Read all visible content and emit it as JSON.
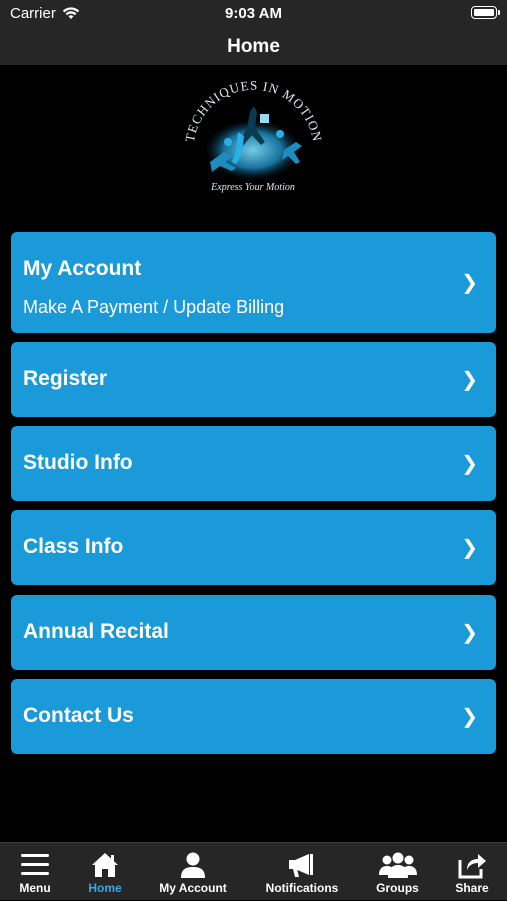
{
  "status_bar": {
    "carrier": "Carrier",
    "time": "9:03 AM"
  },
  "nav": {
    "title": "Home"
  },
  "logo": {
    "text_top": "TECHNIQUES IN MOTION",
    "tagline": "Express Your Motion"
  },
  "menu": [
    {
      "title": "My Account",
      "subtitle": "Make A Payment / Update Billing"
    },
    {
      "title": "Register"
    },
    {
      "title": "Studio Info"
    },
    {
      "title": "Class Info"
    },
    {
      "title": "Annual Recital"
    },
    {
      "title": "Contact Us"
    }
  ],
  "chevron": "❯",
  "tabs": [
    {
      "label": "Menu",
      "icon": "hamburger-icon"
    },
    {
      "label": "Home",
      "icon": "home-icon",
      "active": true
    },
    {
      "label": "My Account",
      "icon": "person-icon"
    },
    {
      "label": "Notifications",
      "icon": "megaphone-icon"
    },
    {
      "label": "Groups",
      "icon": "group-icon"
    },
    {
      "label": "Share",
      "icon": "share-icon"
    }
  ],
  "colors": {
    "accent": "#1a9ad8",
    "bars": "#262626",
    "active_tab": "#3aa7e4"
  }
}
